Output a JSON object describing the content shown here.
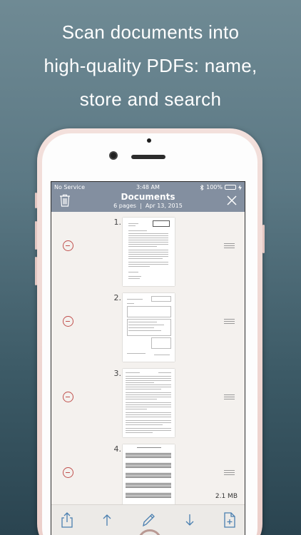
{
  "promo": {
    "line1": "Scan documents into",
    "line2": "high-quality PDFs: name,",
    "line3": "store and search"
  },
  "status_bar": {
    "carrier": "No Service",
    "time": "3:48 AM",
    "battery": "100%"
  },
  "navbar": {
    "title": "Documents",
    "subtitle": "6 pages  |  Apr 13, 2015"
  },
  "pages": [
    {
      "number": "1."
    },
    {
      "number": "2."
    },
    {
      "number": "3."
    },
    {
      "number": "4."
    }
  ],
  "file_size": "2.1 MB",
  "colors": {
    "accent_red": "#c0504d",
    "navbar": "#838fa0",
    "toolbar_icon": "#4a7fb0"
  },
  "icons": {
    "trash": "trash-icon",
    "close": "close-icon",
    "share": "share-icon",
    "move_up": "arrow-up-icon",
    "edit": "pencil-icon",
    "move_down": "arrow-down-icon",
    "add_page": "add-page-icon"
  }
}
